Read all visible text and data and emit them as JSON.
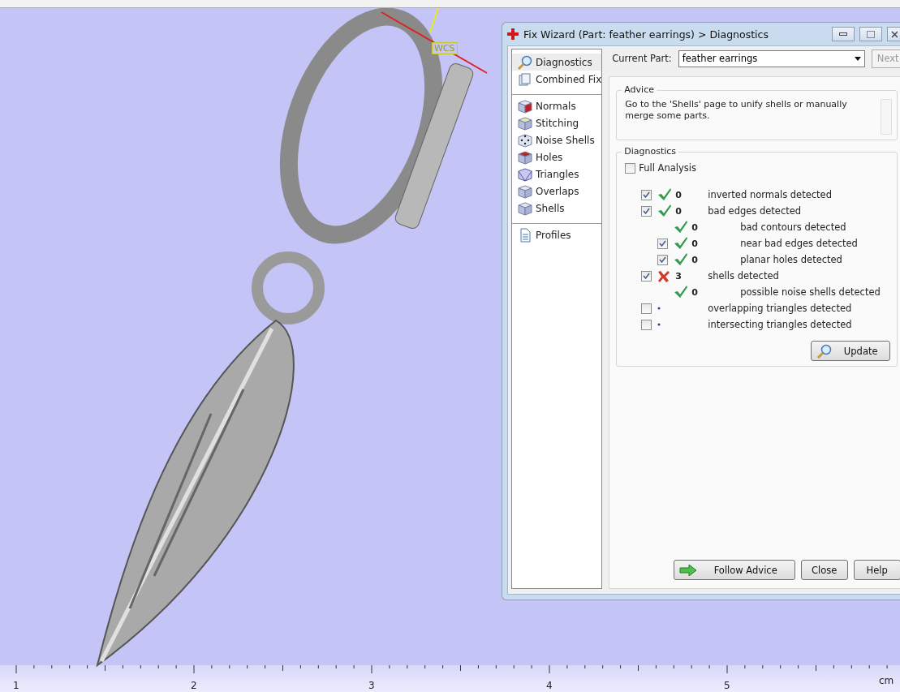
{
  "viewport": {
    "axis_label": "WCS"
  },
  "wizard": {
    "title": "Fix Wizard (Part: feather earrings) > Diagnostics",
    "nav_groups": [
      [
        {
          "label": "Diagnostics",
          "selected": true
        },
        {
          "label": "Combined Fix",
          "selected": false
        }
      ],
      [
        {
          "label": "Normals",
          "selected": false
        },
        {
          "label": "Stitching",
          "selected": false
        },
        {
          "label": "Noise Shells",
          "selected": false
        },
        {
          "label": "Holes",
          "selected": false
        },
        {
          "label": "Triangles",
          "selected": false
        },
        {
          "label": "Overlaps",
          "selected": false
        },
        {
          "label": "Shells",
          "selected": false
        }
      ],
      [
        {
          "label": "Profiles",
          "selected": false
        }
      ]
    ],
    "current_part_label": "Current Part:",
    "current_part": "feather earrings",
    "next_button": {
      "label": "Next",
      "disabled": true
    },
    "advice": {
      "title": "Advice",
      "text": "Go to the 'Shells' page to unify shells or manually merge some parts."
    },
    "diagnostics": {
      "title": "Diagnostics",
      "full_analysis": {
        "label": "Full Analysis",
        "checked": false
      },
      "checks": [
        {
          "kind": "ok",
          "checked": true,
          "count": "0",
          "label": "inverted normals detected"
        },
        {
          "kind": "ok",
          "checked": true,
          "count": "0",
          "label": "bad edges detected",
          "children": [
            {
              "kind": "ok",
              "count": "0",
              "label": "bad contours detected"
            },
            {
              "kind": "ok",
              "checked": true,
              "count": "0",
              "label": "near bad edges detected"
            },
            {
              "kind": "ok",
              "checked": true,
              "count": "0",
              "label": "planar holes detected"
            }
          ]
        },
        {
          "kind": "error",
          "checked": true,
          "count": "3",
          "label": "shells detected",
          "children": [
            {
              "kind": "ok",
              "count": "0",
              "label": "possible noise shells detected"
            }
          ]
        },
        {
          "kind": "pending",
          "checked": false,
          "label": "overlapping triangles detected"
        },
        {
          "kind": "pending",
          "checked": false,
          "label": "intersecting triangles detected"
        }
      ],
      "update_button": "Update"
    },
    "buttons": [
      {
        "label": "Follow Advice",
        "kind": "advice"
      },
      {
        "label": "Close",
        "kind": "plain"
      },
      {
        "label": "Help",
        "kind": "plain"
      }
    ]
  },
  "ruler": {
    "labels": [
      "1",
      "2",
      "3",
      "4",
      "5"
    ],
    "unit": "cm"
  }
}
